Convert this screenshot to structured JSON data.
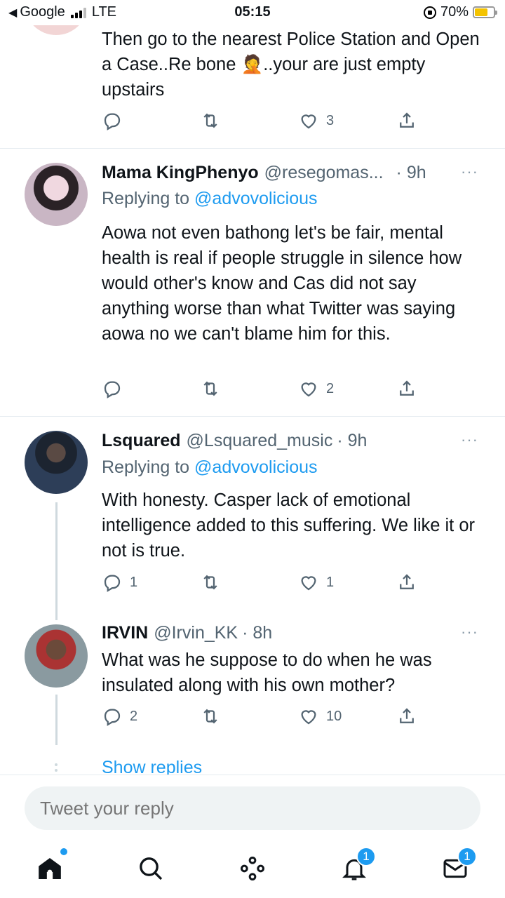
{
  "status_bar": {
    "back_app": "Google",
    "network": "LTE",
    "time": "05:15",
    "battery": "70%",
    "battery_level": 0.7
  },
  "tweets": [
    {
      "text": "Then go to the nearest Police Station and Open a Case..Re bone 🤦..your are just empty upstairs",
      "reply_count": "",
      "retweet_count": "",
      "like_count": "3"
    },
    {
      "name": "Mama KingPhenyo",
      "handle": "@resegomas...",
      "time": "· 9h",
      "replying_prefix": "Replying to",
      "replying_to": "@advovolicious",
      "text": "Aowa not even bathong let's be fair, mental health is real if people struggle in silence how would other's know and Cas did not say anything worse than what Twitter was saying aowa no we can't blame him for this.",
      "reply_count": "",
      "retweet_count": "",
      "like_count": "2"
    },
    {
      "name": "Lsquared",
      "handle": "@Lsquared_music",
      "time": "· 9h",
      "replying_prefix": "Replying to",
      "replying_to": "@advovolicious",
      "text": "With honesty. Casper lack of emotional intelligence added to this suffering. We like it or not is true.",
      "reply_count": "1",
      "retweet_count": "",
      "like_count": "1"
    },
    {
      "name": "IRVIN",
      "handle": "@Irvin_KK",
      "time": "· 8h",
      "text": "What was he suppose to do when he was insulated along with his own mother?",
      "reply_count": "2",
      "retweet_count": "",
      "like_count": "10"
    }
  ],
  "more_icon": "···",
  "show_replies": "Show replies",
  "reply_box": {
    "placeholder": "Tweet your reply"
  },
  "tab_bar": {
    "notifications_badge": "1",
    "messages_badge": "1"
  },
  "colors": {
    "accent": "#1d9bf0",
    "muted": "#536471"
  }
}
